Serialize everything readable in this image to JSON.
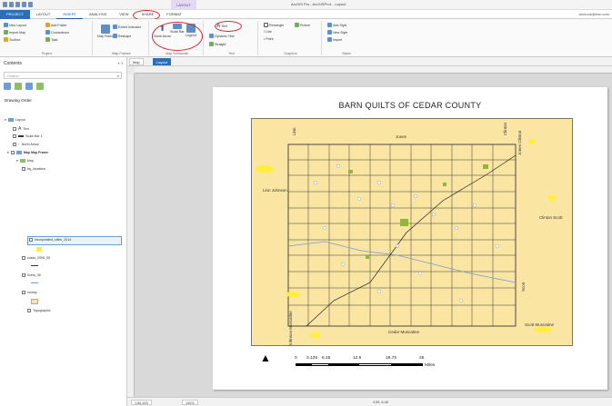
{
  "app": {
    "window_title": "ArcGIS Pro - ArcGISPro1 - Layout",
    "context_tab": "LAYOUT",
    "user": "arcbook@esri.com"
  },
  "ribbon": {
    "tabs": [
      "PROJECT",
      "LAYOUT",
      "INSERT",
      "ANALYSIS",
      "VIEW",
      "SHARE",
      "FORMAT"
    ],
    "active_tab": "INSERT",
    "highlighted_tab": "SHARE",
    "groups": {
      "project": {
        "label": "Project",
        "items": [
          "New Layout",
          "Import Map",
          "Toolbox",
          "Add Folder",
          "Connections",
          "Task"
        ]
      },
      "map_frames": {
        "label": "Map Frames",
        "items": [
          "Map Frame",
          "Extent Indicator",
          "Reshape"
        ]
      },
      "map_surrounds": {
        "label": "Map Surrounds",
        "items": [
          "North Arrow",
          "Scale Bar",
          "Legend"
        ]
      },
      "text": {
        "label": "Text",
        "items": [
          "Text",
          "Dynamic Text",
          "Straight"
        ]
      },
      "graphics": {
        "label": "Graphics",
        "items": [
          "Rectangle",
          "Line",
          "Point",
          "Picture"
        ]
      },
      "styles": {
        "label": "Styles",
        "items": [
          "Add Style",
          "New Style",
          "Import"
        ]
      }
    }
  },
  "contents": {
    "title": "Contents",
    "search_placeholder": "Search",
    "drawing_order_label": "Drawing Order",
    "layers": [
      {
        "name": "Layout",
        "level": 0
      },
      {
        "name": "Text",
        "level": 1
      },
      {
        "name": "Scale Bar 1",
        "level": 1
      },
      {
        "name": "North Arrow",
        "level": 1
      },
      {
        "name": "Map Map Frame",
        "level": 1
      },
      {
        "name": "Map",
        "level": 2
      },
      {
        "name": "bq_locations",
        "level": 3
      },
      {
        "name": "incorporated_cities_2014",
        "level": 3
      },
      {
        "name": "roads_2006_05",
        "level": 3
      },
      {
        "name": "rivers_06",
        "level": 3
      },
      {
        "name": "county",
        "level": 3
      },
      {
        "name": "Topographic",
        "level": 3
      }
    ]
  },
  "doc_tabs": [
    "Map",
    "Layout"
  ],
  "active_doc_tab": "Layout",
  "layout": {
    "map_title": "BARN QUILTS OF CEDAR COUNTY",
    "north_arrow": "▲",
    "scale_labels": [
      "0",
      "3.125",
      "6.25",
      "12.5",
      "18.75",
      "25"
    ],
    "scale_unit": "Miles",
    "county_labels": [
      "Linn",
      "Jones",
      "Linn Johnson",
      "Jones Clinton",
      "Clinton",
      "Clinton Scott",
      "Cedar Muscatine",
      "Scott",
      "Scott Muscatine",
      "Johnson Muscatine"
    ],
    "map_colors": {
      "land": "#fbe5a3",
      "roads": "#333333",
      "towns": "#8fb83a",
      "highlight": "#ffef3a"
    }
  },
  "status": {
    "scale": "1:66,525",
    "zoom": "105%",
    "coords": "4.59, 6.49"
  }
}
